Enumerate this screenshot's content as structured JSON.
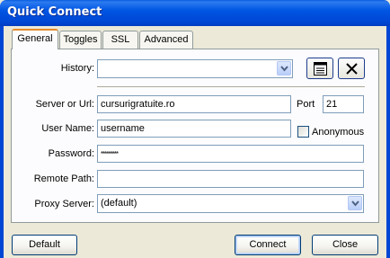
{
  "window": {
    "title": "Quick Connect"
  },
  "tabs": [
    {
      "label": "General",
      "active": true
    },
    {
      "label": "Toggles",
      "active": false
    },
    {
      "label": "SSL",
      "active": false
    },
    {
      "label": "Advanced",
      "active": false
    }
  ],
  "form": {
    "history": {
      "label": "History:",
      "value": ""
    },
    "server": {
      "label": "Server or Url:",
      "value": "cursurigratuite.ro"
    },
    "port": {
      "label": "Port",
      "value": "21"
    },
    "username": {
      "label": "User Name:",
      "value": "username"
    },
    "anonymous": {
      "label": "Anonymous",
      "checked": false
    },
    "password": {
      "label": "Password:",
      "value": "*********"
    },
    "remote_path": {
      "label": "Remote Path:",
      "value": ""
    },
    "proxy": {
      "label": "Proxy Server:",
      "value": "(default)"
    }
  },
  "buttons": {
    "default_label": "Default",
    "connect_label": "Connect",
    "close_label": "Close"
  },
  "icons": {
    "history_list": "list-icon",
    "history_clear": "x-icon",
    "combo_arrow": "chevron-down-icon"
  },
  "colors": {
    "titlebar": "#0055e3",
    "tab_highlight": "#e68b2c",
    "dialog_bg": "#ece9d8",
    "field_border": "#7f9db9"
  }
}
